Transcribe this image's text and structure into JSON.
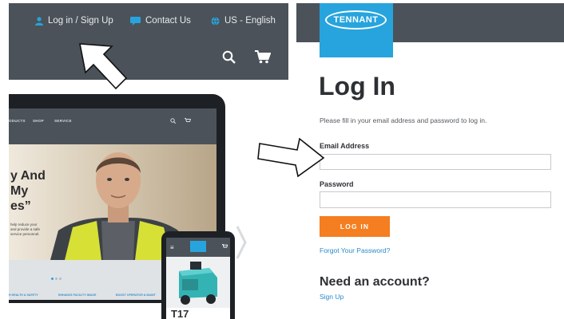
{
  "site_header": {
    "login_label": "Log in / Sign Up",
    "contact_label": "Contact Us",
    "language_label": "US - English",
    "icons": [
      "user-icon",
      "chat-icon",
      "globe-icon",
      "search-icon",
      "cart-icon"
    ]
  },
  "laptop_site": {
    "nav_items": [
      "ODUCTS",
      "SHOP",
      "SERVICE"
    ],
    "hero_line1": "y And",
    "hero_line2": "My",
    "hero_line3": "es”",
    "hero_small": "help reduce your and provide a safe service personnel.",
    "links": [
      "H HEALTH & SAFETY",
      "ENHANCE FACILITY IMAGE",
      "BOOST OPERATOR & MAINT"
    ]
  },
  "phone_site": {
    "menu_glyph": "≡",
    "title": "T17"
  },
  "login_page": {
    "logo_text": "TENNANT",
    "title": "Log In",
    "instructions": "Please fill in your email address and password to log in.",
    "email_label": "Email Address",
    "email_value": "",
    "password_label": "Password",
    "password_value": "",
    "login_button": "LOG IN",
    "forgot_link": "Forgot Your Password?",
    "need_account": "Need an account?",
    "signup_link": "Sign Up"
  },
  "colors": {
    "header_gray": "#4b5259",
    "brand_blue": "#27a4dd",
    "button_orange": "#f47e20",
    "link_blue": "#2a8bc9"
  }
}
